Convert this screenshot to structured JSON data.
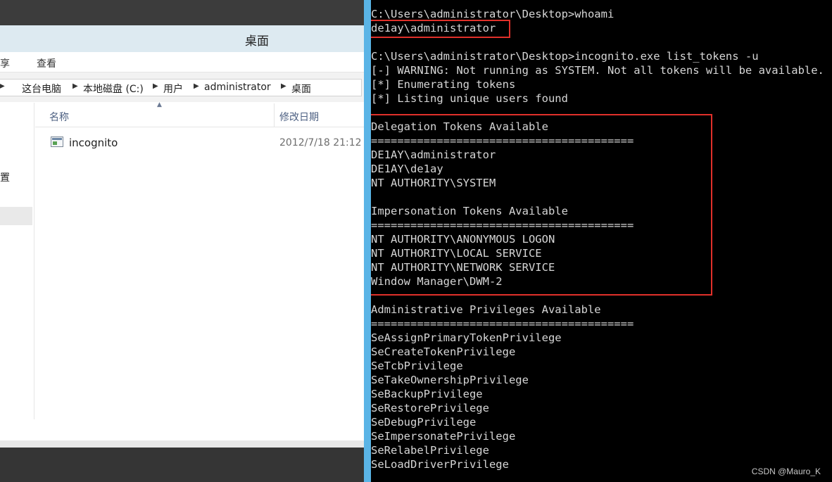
{
  "explorer": {
    "title": "桌面",
    "ribbon_tabs": [
      "共享",
      "查看"
    ],
    "breadcrumb": [
      "这台电脑",
      "本地磁盘 (C:)",
      "用户",
      "administrator",
      "桌面"
    ],
    "nav_label": "置",
    "columns": {
      "name": "名称",
      "modified": "修改日期"
    },
    "files": [
      {
        "name": "incognito",
        "modified": "2012/7/18 21:12"
      }
    ]
  },
  "console": {
    "lines": [
      "C:\\Users\\administrator\\Desktop>whoami",
      "de1ay\\administrator",
      "",
      "C:\\Users\\administrator\\Desktop>incognito.exe list_tokens -u",
      "[-] WARNING: Not running as SYSTEM. Not all tokens will be available.",
      "[*] Enumerating tokens",
      "[*] Listing unique users found",
      "",
      "Delegation Tokens Available",
      "========================================",
      "DE1AY\\administrator",
      "DE1AY\\de1ay",
      "NT AUTHORITY\\SYSTEM",
      "",
      "Impersonation Tokens Available",
      "========================================",
      "NT AUTHORITY\\ANONYMOUS LOGON",
      "NT AUTHORITY\\LOCAL SERVICE",
      "NT AUTHORITY\\NETWORK SERVICE",
      "Window Manager\\DWM-2",
      "",
      "Administrative Privileges Available",
      "========================================",
      "SeAssignPrimaryTokenPrivilege",
      "SeCreateTokenPrivilege",
      "SeTcbPrivilege",
      "SeTakeOwnershipPrivilege",
      "SeBackupPrivilege",
      "SeRestorePrivilege",
      "SeDebugPrivilege",
      "SeImpersonatePrivilege",
      "SeRelabelPrivilege",
      "SeLoadDriverPrivilege"
    ],
    "highlight_color": "#e0302a"
  },
  "watermark": "CSDN @Mauro_K"
}
